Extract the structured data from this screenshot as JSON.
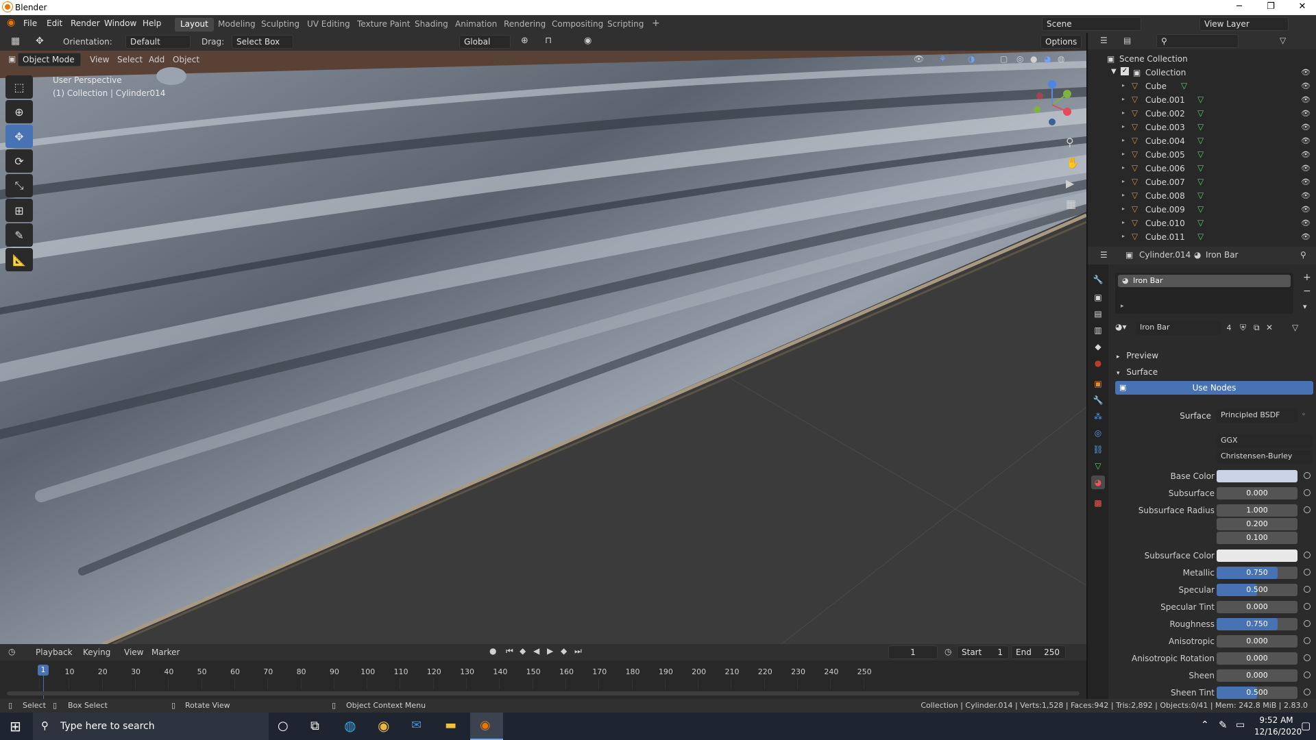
{
  "window": {
    "title": "Blender",
    "minimize": "─",
    "maximize": "❐",
    "close": "✕"
  },
  "menu": [
    "File",
    "Edit",
    "Render",
    "Window",
    "Help"
  ],
  "workspaces": [
    "Layout",
    "Modeling",
    "Sculpting",
    "UV Editing",
    "Texture Paint",
    "Shading",
    "Animation",
    "Rendering",
    "Compositing",
    "Scripting"
  ],
  "workspace_add": "+",
  "scene": {
    "name": "Scene",
    "view_layer": "View Layer"
  },
  "header": {
    "orientation_label": "Orientation:",
    "orientation_value": "Default",
    "drag_label": "Drag:",
    "drag_value": "Select Box",
    "transform": "Global",
    "options": "Options"
  },
  "viewport_header": {
    "mode": "Object Mode",
    "menus": [
      "View",
      "Select",
      "Add",
      "Object"
    ]
  },
  "viewport": {
    "perspective": "User Perspective",
    "collection": "(1) Collection | Cylinder014"
  },
  "outliner": {
    "search_placeholder": "",
    "scene_collection": "Scene Collection",
    "collection": "Collection",
    "items": [
      "Cube",
      "Cube.001",
      "Cube.002",
      "Cube.003",
      "Cube.004",
      "Cube.005",
      "Cube.006",
      "Cube.007",
      "Cube.008",
      "Cube.009",
      "Cube.010",
      "Cube.011"
    ]
  },
  "properties": {
    "object": "Cylinder.014",
    "material": "Iron Bar",
    "slot": "Iron Bar",
    "material_field": "Iron Bar",
    "users": "4",
    "preview": "Preview",
    "surface_section": "Surface",
    "use_nodes": "Use Nodes",
    "surface_label": "Surface",
    "surface_value": "Principled BSDF",
    "distribution": "GGX",
    "subsurface_method": "Christensen-Burley",
    "rows": [
      {
        "label": "Base Color",
        "value": "",
        "type": "color",
        "color": "#c9d3e6"
      },
      {
        "label": "Subsurface",
        "value": "0.000",
        "fill": 0
      },
      {
        "label": "Subsurface Radius",
        "value": "1.000",
        "fill": 0
      },
      {
        "label": "",
        "value": "0.200",
        "fill": 0
      },
      {
        "label": "",
        "value": "0.100",
        "fill": 0
      },
      {
        "label": "Subsurface Color",
        "value": "",
        "type": "color",
        "color": "#e8e8e8"
      },
      {
        "label": "Metallic",
        "value": "0.750",
        "fill": 0.75
      },
      {
        "label": "Specular",
        "value": "0.500",
        "fill": 0.5
      },
      {
        "label": "Specular Tint",
        "value": "0.000",
        "fill": 0
      },
      {
        "label": "Roughness",
        "value": "0.750",
        "fill": 0.75
      },
      {
        "label": "Anisotropic",
        "value": "0.000",
        "fill": 0
      },
      {
        "label": "Anisotropic Rotation",
        "value": "0.000",
        "fill": 0
      },
      {
        "label": "Sheen",
        "value": "0.000",
        "fill": 0
      },
      {
        "label": "Sheen Tint",
        "value": "0.500",
        "fill": 0.5
      }
    ]
  },
  "timeline": {
    "menus": [
      "Playback",
      "Keying",
      "View",
      "Marker"
    ],
    "current_frame": "1",
    "start_label": "Start",
    "start": "1",
    "end_label": "End",
    "end": "250",
    "ticks": [
      "1",
      "10",
      "20",
      "30",
      "40",
      "50",
      "60",
      "70",
      "80",
      "90",
      "100",
      "110",
      "120",
      "130",
      "140",
      "150",
      "160",
      "170",
      "180",
      "190",
      "200",
      "210",
      "220",
      "230",
      "240",
      "250"
    ]
  },
  "statusbar": {
    "select": "Select",
    "box_select": "Box Select",
    "rotate_view": "Rotate View",
    "context_menu": "Object Context Menu",
    "stats": "Collection | Cylinder.014 | Verts:1,528 | Faces:942 | Tris:2,892 | Objects:0/41 | Mem: 242.8 MiB | 2.83.0"
  },
  "taskbar": {
    "search_placeholder": "Type here to search",
    "time": "9:52 AM",
    "date": "12/16/2020"
  },
  "colors": {
    "accent": "#4772b3",
    "panel": "#303030",
    "dark": "#1d1d1d"
  }
}
